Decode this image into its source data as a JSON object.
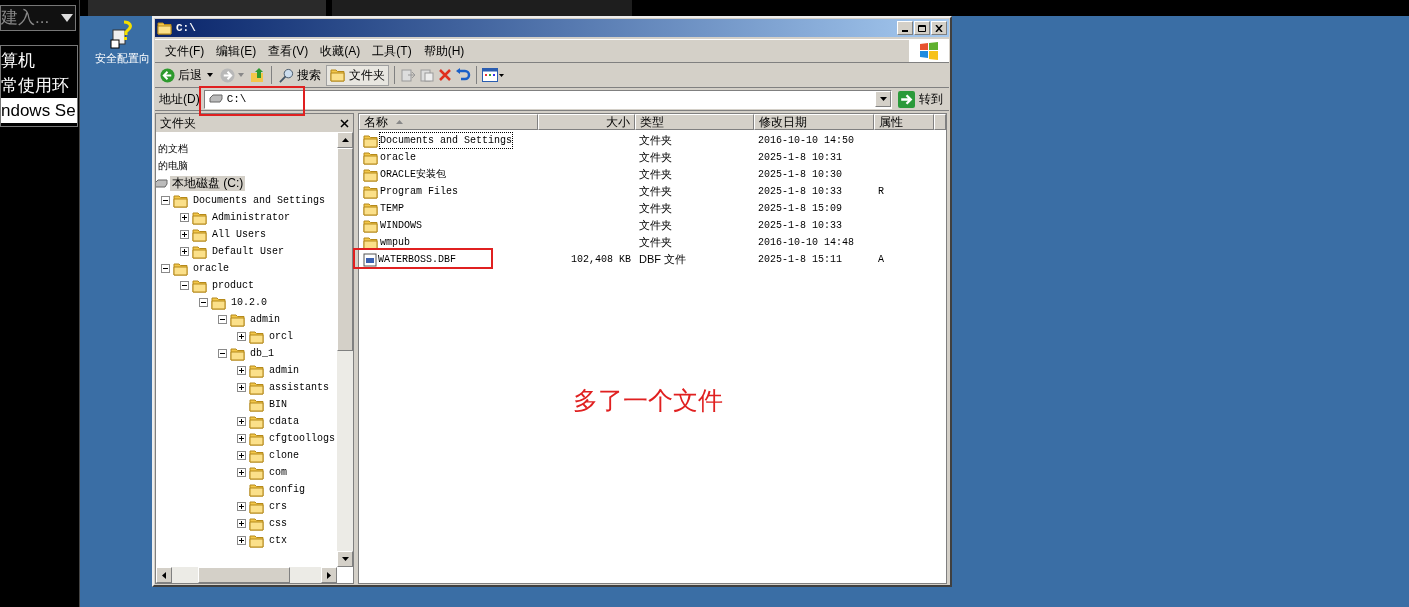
{
  "side_panel": {
    "dropdown": {
      "value": "建入..."
    },
    "items": [
      {
        "label": "算机",
        "selected": false
      },
      {
        "label": "常使用环",
        "selected": false
      },
      {
        "label": "ndows Se",
        "selected": true
      }
    ]
  },
  "desktop_icons": [
    {
      "label": "安全配置向"
    }
  ],
  "window": {
    "title": "C:\\",
    "menu": [
      "文件(F)",
      "编辑(E)",
      "查看(V)",
      "收藏(A)",
      "工具(T)",
      "帮助(H)"
    ],
    "toolbar": {
      "back": "后退",
      "search": "搜索",
      "folders": {
        "label": "文件夹",
        "selected": true
      }
    },
    "address": {
      "label": "地址(D)",
      "value": "C:\\",
      "go": "转到"
    },
    "folders_pane": {
      "title": "文件夹",
      "tree": [
        {
          "label": "的文档",
          "selected": false
        },
        {
          "label": "的电脑",
          "selected": false
        },
        {
          "label": "本地磁盘 (C:)",
          "kind": "drive",
          "selected": true,
          "children": [
            {
              "label": "Documents and Settings",
              "expanded": true,
              "selected": false,
              "children": [
                {
                  "label": "Administrator",
                  "expanded": false,
                  "selected": false
                },
                {
                  "label": "All Users",
                  "expanded": false,
                  "selected": false
                },
                {
                  "label": "Default User",
                  "expanded": false,
                  "selected": false
                }
              ]
            },
            {
              "label": "oracle",
              "expanded": true,
              "selected": false,
              "children": [
                {
                  "label": "product",
                  "expanded": true,
                  "selected": false,
                  "children": [
                    {
                      "label": "10.2.0",
                      "expanded": true,
                      "selected": false,
                      "children": [
                        {
                          "label": "admin",
                          "expanded": true,
                          "selected": false,
                          "children": [
                            {
                              "label": "orcl",
                              "expanded": false,
                              "selected": false
                            }
                          ]
                        },
                        {
                          "label": "db_1",
                          "expanded": true,
                          "selected": false,
                          "children": [
                            {
                              "label": "admin",
                              "expanded": false,
                              "selected": false
                            },
                            {
                              "label": "assistants",
                              "expanded": false,
                              "selected": false
                            },
                            {
                              "label": "BIN",
                              "selected": false
                            },
                            {
                              "label": "cdata",
                              "expanded": false,
                              "selected": false
                            },
                            {
                              "label": "cfgtoollogs",
                              "expanded": false,
                              "selected": false
                            },
                            {
                              "label": "clone",
                              "expanded": false,
                              "selected": false
                            },
                            {
                              "label": "com",
                              "expanded": false,
                              "selected": false
                            },
                            {
                              "label": "config",
                              "selected": false
                            },
                            {
                              "label": "crs",
                              "expanded": false,
                              "selected": false
                            },
                            {
                              "label": "css",
                              "expanded": false,
                              "selected": false
                            },
                            {
                              "label": "ctx",
                              "expanded": false,
                              "selected": false
                            }
                          ]
                        }
                      ]
                    }
                  ]
                }
              ]
            }
          ]
        }
      ]
    },
    "file_list": {
      "columns": [
        "名称",
        "大小",
        "类型",
        "修改日期",
        "属性"
      ],
      "rows": [
        {
          "kind": "folder",
          "name": "Documents and Settings",
          "size": "",
          "type": "文件夹",
          "modified": "2016-10-10 14:50",
          "attributes": "",
          "focused": true
        },
        {
          "kind": "folder",
          "name": "oracle",
          "size": "",
          "type": "文件夹",
          "modified": "2025-1-8 10:31",
          "attributes": "",
          "focused": false
        },
        {
          "kind": "folder",
          "name": "ORACLE安装包",
          "size": "",
          "type": "文件夹",
          "modified": "2025-1-8 10:30",
          "attributes": "",
          "focused": false
        },
        {
          "kind": "folder",
          "name": "Program Files",
          "size": "",
          "type": "文件夹",
          "modified": "2025-1-8 10:33",
          "attributes": "R",
          "focused": false
        },
        {
          "kind": "folder",
          "name": "TEMP",
          "size": "",
          "type": "文件夹",
          "modified": "2025-1-8 15:09",
          "attributes": "",
          "focused": false
        },
        {
          "kind": "folder",
          "name": "WINDOWS",
          "size": "",
          "type": "文件夹",
          "modified": "2025-1-8 10:33",
          "attributes": "",
          "focused": false
        },
        {
          "kind": "folder",
          "name": "wmpub",
          "size": "",
          "type": "文件夹",
          "modified": "2016-10-10 14:48",
          "attributes": "",
          "focused": false
        },
        {
          "kind": "file",
          "name": "WATERBOSS.DBF",
          "size": "102,408 KB",
          "type": "DBF 文件",
          "modified": "2025-1-8 15:11",
          "attributes": "A",
          "focused": false
        }
      ]
    }
  },
  "annotation": {
    "text": "多了一个文件"
  }
}
